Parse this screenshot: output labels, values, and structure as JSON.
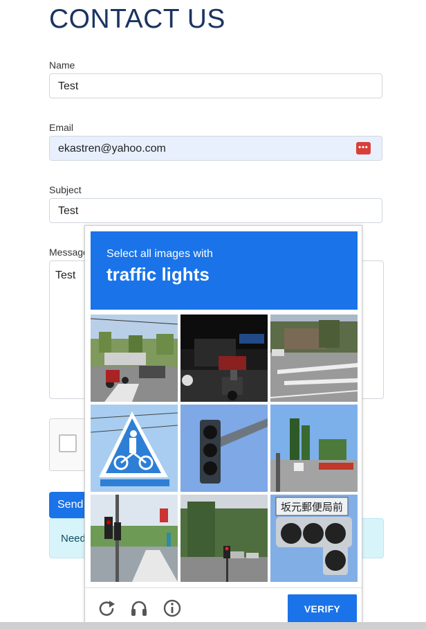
{
  "page": {
    "title": "CONTACT US"
  },
  "form": {
    "name_label": "Name",
    "name_value": "Test",
    "email_label": "Email",
    "email_value": "ekastren@yahoo.com",
    "subject_label": "Subject",
    "subject_value": "Test",
    "message_label": "Message",
    "message_value": "Test",
    "send_label": "Send",
    "help_text": "Need",
    "password_manager_icon": "password-manager-icon"
  },
  "captcha": {
    "prompt": "Select all images with",
    "target": "traffic lights",
    "verify_label": "VERIFY",
    "tiles": [
      {
        "scene": "street intersection with motorbikes"
      },
      {
        "scene": "night street with motorbikes"
      },
      {
        "scene": "empty crosswalk road"
      },
      {
        "scene": "bicycle crossing sign"
      },
      {
        "scene": "traffic light close-up"
      },
      {
        "scene": "road with trees"
      },
      {
        "scene": "traffic lights by road"
      },
      {
        "scene": "street with traffic light"
      },
      {
        "scene": "traffic light with sign"
      }
    ],
    "tile7_sign_text": "坂元郵便局前",
    "footer_icons": [
      "reload-icon",
      "audio-icon",
      "info-icon"
    ],
    "colors": {
      "accent": "#1a73e8"
    }
  }
}
